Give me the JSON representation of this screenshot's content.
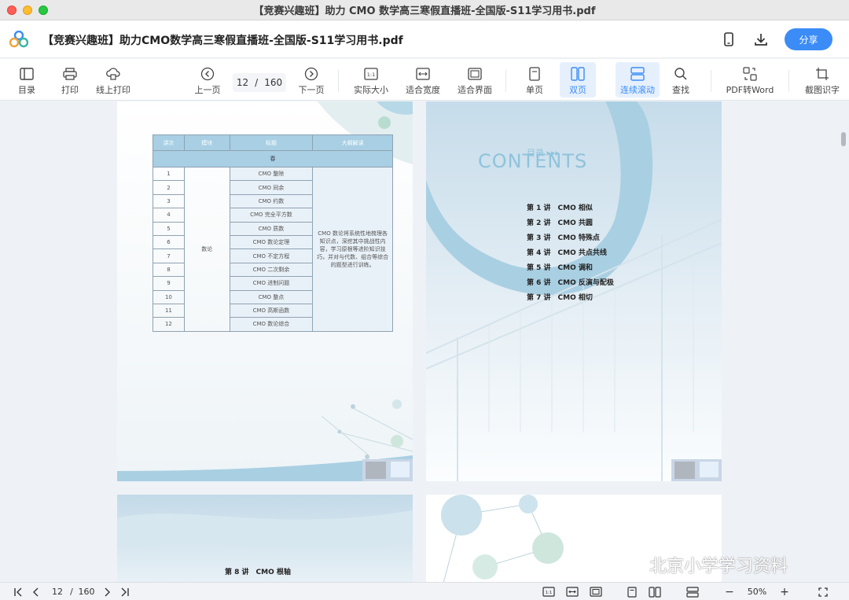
{
  "window": {
    "title": "【竞赛兴趣班】助力 CMO 数学高三寒假直播班-全国版-S11学习用书.pdf"
  },
  "header": {
    "doc_title": "【竞赛兴趣班】助力CMO数学高三寒假直播班-全国版-S11学习用书.pdf",
    "share_label": "分享",
    "icons": [
      "app-logo-icon",
      "phone-icon",
      "download-icon"
    ]
  },
  "toolbar": {
    "toc": "目录",
    "print": "打印",
    "online_print": "线上打印",
    "prev_page": "上一页",
    "next_page": "下一页",
    "current_page": "12",
    "separator": "/",
    "total_pages": "160",
    "actual_size": "实际大小",
    "fit_width": "适合宽度",
    "fit_window": "适合界面",
    "single_page": "单页",
    "double_page": "双页",
    "continuous_scroll": "连续滚动",
    "search": "查找",
    "pdf_to_word": "PDF转Word",
    "ocr": "截图识字"
  },
  "left_page": {
    "table": {
      "headers": [
        "讲次",
        "模块",
        "标题",
        "大纲解读"
      ],
      "season": "春",
      "module": "数论",
      "rows": [
        {
          "num": "1",
          "title": "CMO 整除"
        },
        {
          "num": "2",
          "title": "CMO 同余"
        },
        {
          "num": "3",
          "title": "CMO 约数"
        },
        {
          "num": "4",
          "title": "CMO 完全平方数"
        },
        {
          "num": "5",
          "title": "CMO 质数"
        },
        {
          "num": "6",
          "title": "CMO 数论定理"
        },
        {
          "num": "7",
          "title": "CMO 不定方程"
        },
        {
          "num": "8",
          "title": "CMO 二次剩余"
        },
        {
          "num": "9",
          "title": "CMO 进制问题"
        },
        {
          "num": "10",
          "title": "CMO 整点"
        },
        {
          "num": "11",
          "title": "CMO 高斯函数"
        },
        {
          "num": "12",
          "title": "CMO 数论综合"
        }
      ],
      "summary": "CMO 数论将系统性地梳理各知识点，深挖其中挑战性内容，学习原根等进阶知识技巧，并对与代数、组合等综合的题型进行训练。"
    }
  },
  "right_page": {
    "contents_small": "目录 ▸▸▸",
    "contents_word": "CONTENTS",
    "items": [
      "第 1 讲　CMO 相似",
      "第 2 讲　CMO 共圆",
      "第 3 讲　CMO 特殊点",
      "第 4 讲　CMO 共点共线",
      "第 5 讲　CMO 调和",
      "第 6 讲　CMO 反演与配极",
      "第 7 讲　CMO 相切"
    ]
  },
  "lower_left_page": {
    "label": "第 8 讲　CMO 根轴"
  },
  "watermark": {
    "text": "北京小学学习资料"
  },
  "statusbar": {
    "current_page": "12",
    "separator": "/",
    "total_pages": "160",
    "zoom": "50%",
    "zoom_out": "−",
    "zoom_in": "+"
  },
  "colors": {
    "accent": "#3b8cf6",
    "table_header": "#a8cfe3",
    "arc": "#a9cfe2"
  }
}
